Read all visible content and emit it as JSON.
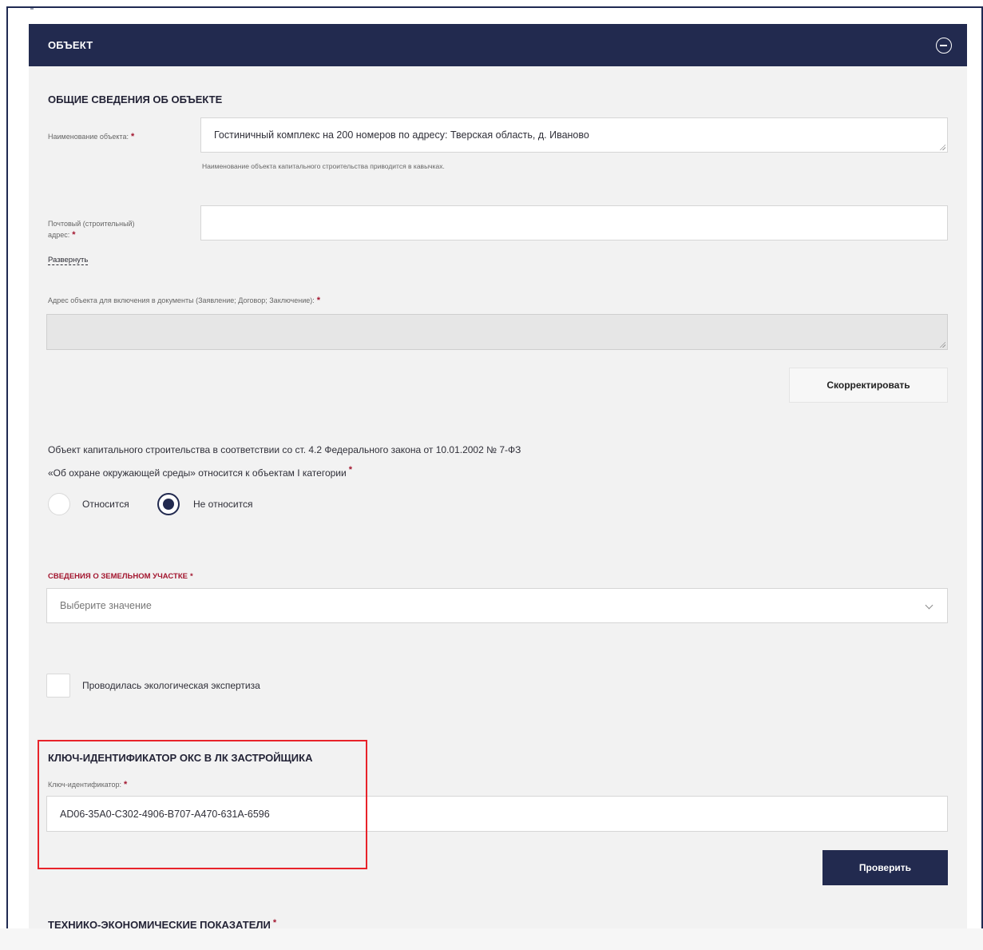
{
  "header": {
    "title": "ОБЪЕКТ"
  },
  "general": {
    "title": "ОБЩИЕ СВЕДЕНИЯ ОБ ОБЪЕКТЕ",
    "name_label": "Наименование объекта:",
    "name_value": "Гостиничный комплекс на 200 номеров по адресу: Тверская область, д. Иваново",
    "name_hint": "Наименование объекта капитального строительства приводится в кавычках.",
    "address_label_line1": "Почтовый (строительный)",
    "address_label_line2": "адрес:",
    "address_value": "",
    "expand_link": "Развернуть",
    "doc_address_label": "Адрес объекта для включения в документы (Заявление; Договор; Заключение):",
    "doc_address_value": "",
    "correct_button": "Скорректировать"
  },
  "category": {
    "text_line1": "Объект капитального строительства в соответствии со ст. 4.2 Федерального закона от 10.01.2002 № 7-ФЗ",
    "text_line2": "«Об охране окружающей среды» относится к объектам I категории",
    "option_yes": "Относится",
    "option_no": "Не относится",
    "selected": "Не относится"
  },
  "land": {
    "title": "СВЕДЕНИЯ О ЗЕМЕЛЬНОМ УЧАСТКЕ",
    "placeholder": "Выберите значение"
  },
  "eco": {
    "checkbox_label": "Проводилась экологическая экспертиза",
    "checked": false
  },
  "key": {
    "title": "КЛЮЧ-ИДЕНТИФИКАТОР ОКС В ЛК ЗАСТРОЙЩИКА",
    "label": "Ключ-идентификатор:",
    "value": "AD06-35A0-C302-4906-B707-A470-631A-6596",
    "check_button": "Проверить"
  },
  "tep": {
    "title": "ТЕХНИКО-ЭКОНОМИЧЕСКИЕ ПОКАЗАТЕЛИ"
  },
  "required_mark": "*",
  "colors": {
    "header_bg": "#222a4f",
    "required": "#a3162f",
    "highlight_box": "#e8232a",
    "panel_bg": "#f2f2f2"
  }
}
